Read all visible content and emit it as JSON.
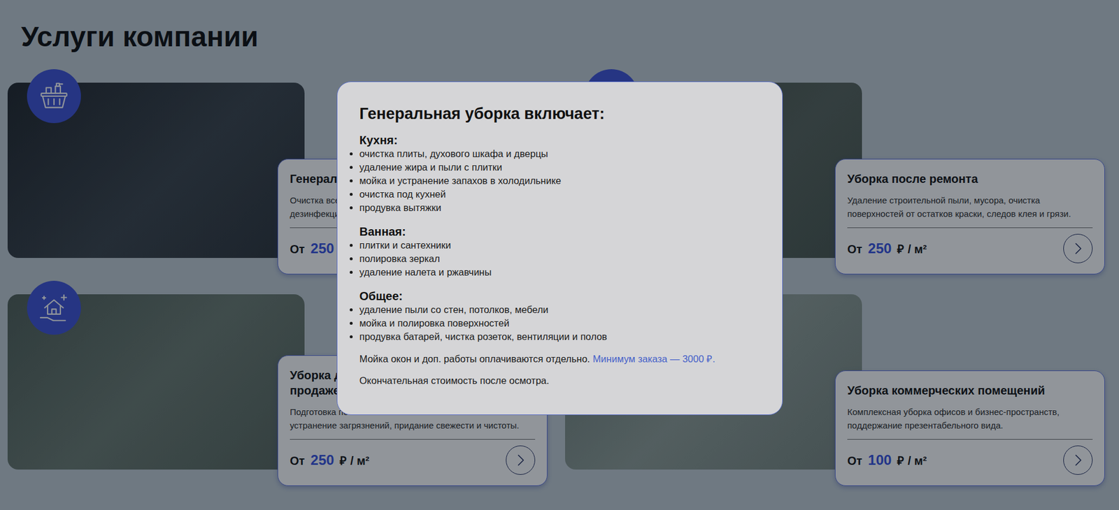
{
  "page": {
    "title": "Услуги компании"
  },
  "services": [
    {
      "title_lines": [
        "Генераль"
      ],
      "description_lines": [
        "Очистка всех",
        "дезинфекция"
      ],
      "price_prefix": "От",
      "price_value": "250",
      "price_unit": "₽ /"
    },
    {
      "title_lines": [
        "Уборка после ремонта"
      ],
      "description_lines": [
        "Удаление строительной пыли, мусора, очистка",
        "поверхностей от остатков краски, следов клея и грязи."
      ],
      "price_prefix": "От",
      "price_value": "250",
      "price_unit": "₽ / м²"
    },
    {
      "title_lines": [
        "Уборка до",
        "продаже)"
      ],
      "description_lines": [
        "Подготовка по",
        "устранение загрязнений, придание свежести и чистоты."
      ],
      "price_prefix": "От",
      "price_value": "250",
      "price_unit": "₽ / м²"
    },
    {
      "title_lines": [
        "Уборка коммерческих помещений"
      ],
      "description_lines": [
        "Комплексная уборка офисов и бизнес-пространств,",
        "поддержание презентабельного вида."
      ],
      "price_prefix": "От",
      "price_value": "100",
      "price_unit": "₽ / м²"
    }
  ],
  "modal": {
    "title": "Генеральная уборка включает:",
    "sections": [
      {
        "heading": "Кухня:",
        "items": [
          "очистка плиты, духового шкафа и дверцы",
          "удаление жира и пыли с плитки",
          "мойка и устранение запахов в холодильнике",
          "очистка под кухней",
          "продувка вытяжки"
        ]
      },
      {
        "heading": "Ванная:",
        "items": [
          "плитки и сантехники",
          "полировка зеркал",
          "удаление налета и ржавчины"
        ]
      },
      {
        "heading": "Общее:",
        "items": [
          "удаление пыли со стен, потолков, мебели",
          "мойка и полировка поверхностей",
          "продувка батарей, чистка розеток, вентиляции и полов"
        ]
      }
    ],
    "note": "Мойка окон и доп. работы оплачиваются отдельно.",
    "note_highlight": "Минимум заказа — 3000 ₽.",
    "footer": "Окончательная стоимость после осмотра."
  }
}
